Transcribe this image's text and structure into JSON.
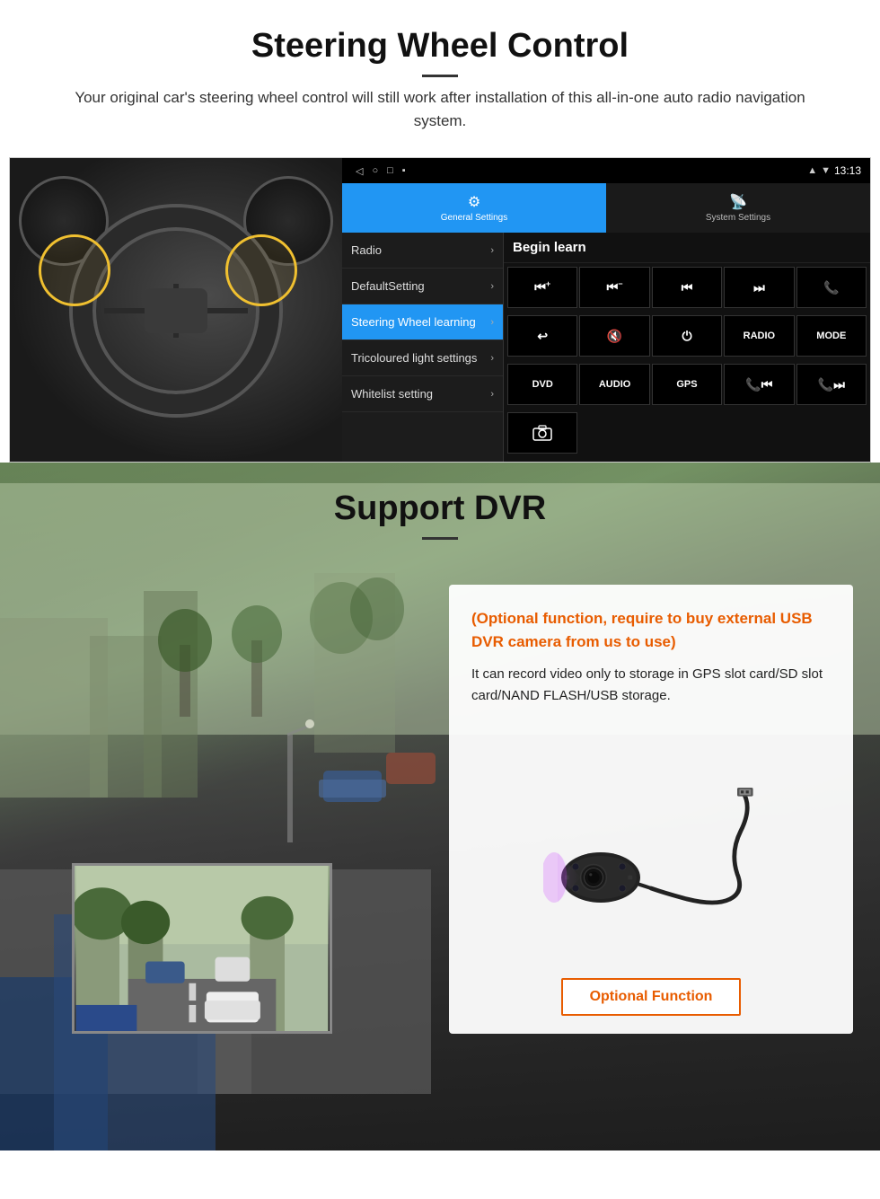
{
  "section1": {
    "title": "Steering Wheel Control",
    "subtitle": "Your original car's steering wheel control will still work after installation of this all-in-one auto radio navigation system.",
    "android": {
      "statusbar": {
        "time": "13:13",
        "icons": [
          "◁",
          "○",
          "□",
          "▪"
        ]
      },
      "tabs": [
        {
          "icon": "⚙",
          "label": "General Settings",
          "active": true
        },
        {
          "icon": "📡",
          "label": "System Settings",
          "active": false
        }
      ],
      "menu_items": [
        {
          "label": "Radio",
          "active": false
        },
        {
          "label": "DefaultSetting",
          "active": false
        },
        {
          "label": "Steering Wheel learning",
          "active": true
        },
        {
          "label": "Tricoloured light settings",
          "active": false
        },
        {
          "label": "Whitelist setting",
          "active": false
        }
      ],
      "begin_learn": "Begin learn",
      "ctrl_buttons_row1": [
        "⏮+",
        "⏮-",
        "⏮",
        "⏭",
        "📞"
      ],
      "ctrl_buttons_row2": [
        "↩",
        "🔇×",
        "⏻",
        "RADIO",
        "MODE"
      ],
      "ctrl_buttons_row3": [
        "DVD",
        "AUDIO",
        "GPS",
        "📞⏮",
        "📞⏭"
      ],
      "ctrl_buttons_row4": [
        "📷"
      ]
    }
  },
  "section2": {
    "title": "Support DVR",
    "optional_text": "(Optional function, require to buy external USB DVR camera from us to use)",
    "description": "It can record video only to storage in GPS slot card/SD slot card/NAND FLASH/USB storage.",
    "optional_btn_label": "Optional Function"
  }
}
